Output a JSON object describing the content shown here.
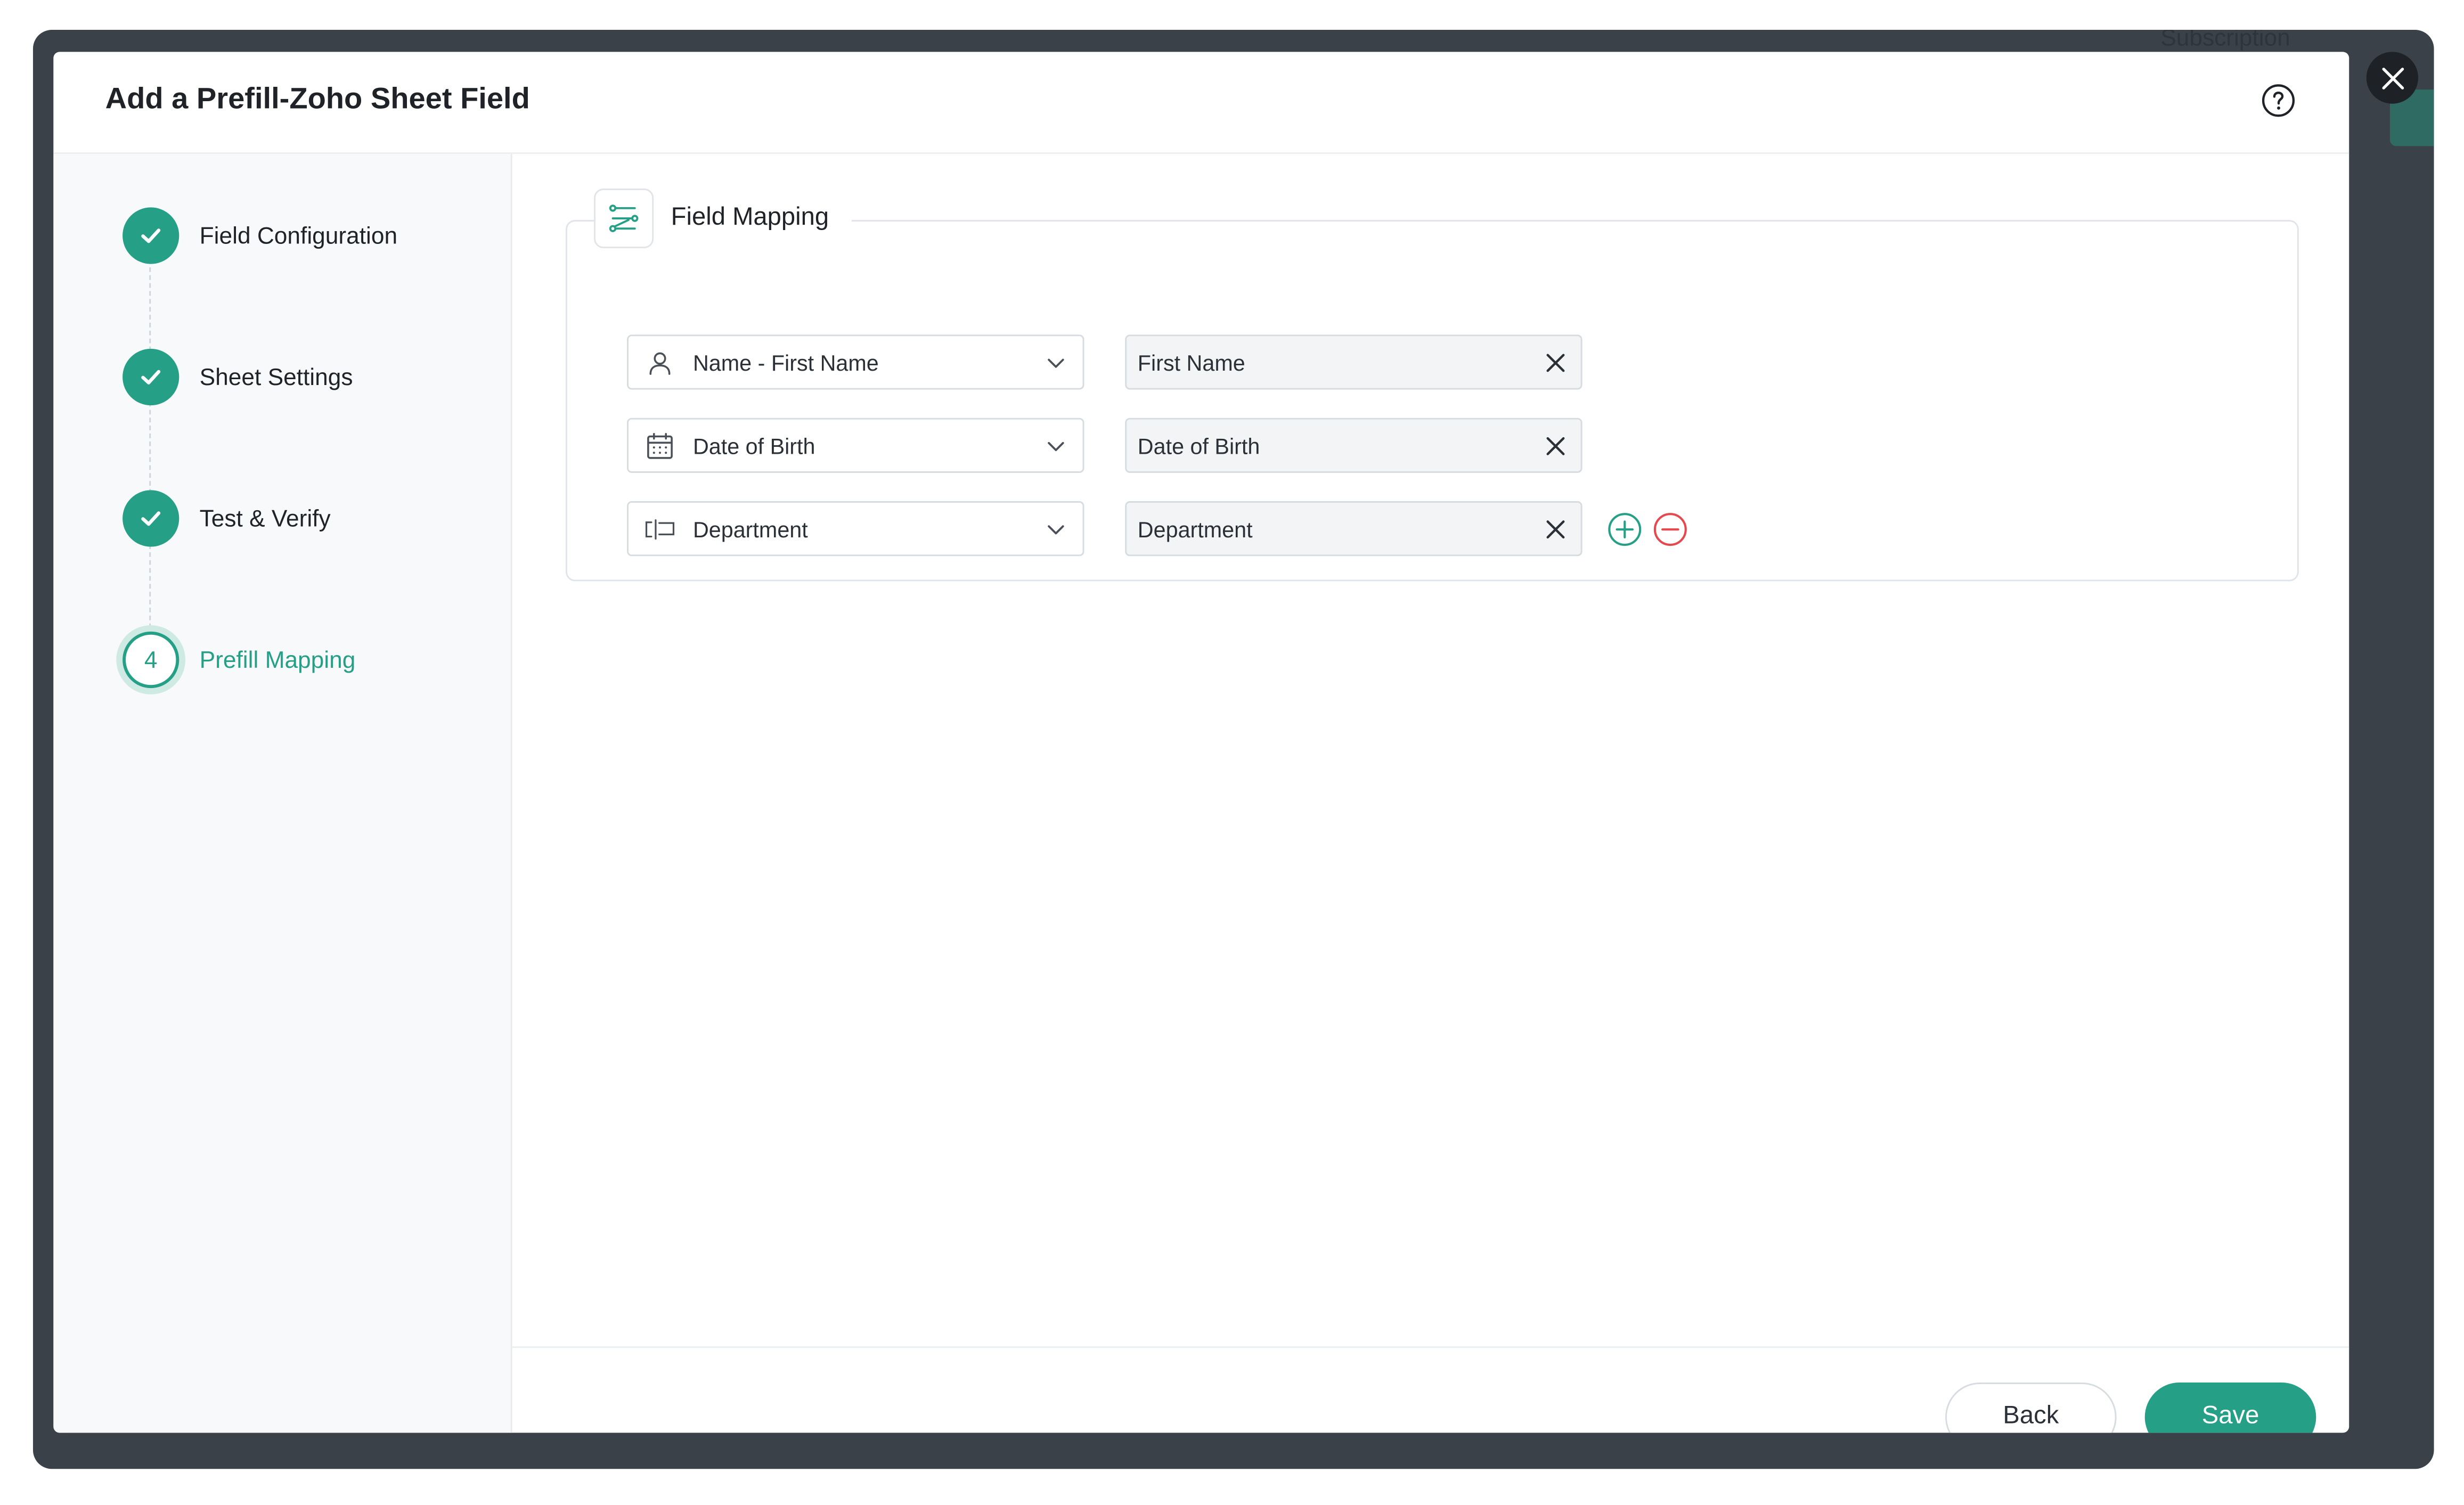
{
  "background": {
    "ghost_text": "Subscription"
  },
  "modal": {
    "title": "Add a Prefill-Zoho Sheet Field"
  },
  "steps": [
    {
      "label": "Field Configuration",
      "state": "done"
    },
    {
      "label": "Sheet Settings",
      "state": "done"
    },
    {
      "label": "Test & Verify",
      "state": "done"
    },
    {
      "label": "Prefill Mapping",
      "state": "active",
      "number": "4"
    }
  ],
  "mapping": {
    "title": "Field Mapping",
    "rows": [
      {
        "source": "Name - First Name",
        "source_icon": "user-icon",
        "target": "First Name"
      },
      {
        "source": "Date of Birth",
        "source_icon": "calendar-icon",
        "target": "Date of Birth"
      },
      {
        "source": "Department",
        "source_icon": "dropdown-field-icon",
        "target": "Department"
      }
    ]
  },
  "footer": {
    "back_label": "Back",
    "save_label": "Save"
  },
  "colors": {
    "accent": "#25a087",
    "danger": "#e5484d",
    "backdrop": "#3a4149"
  }
}
